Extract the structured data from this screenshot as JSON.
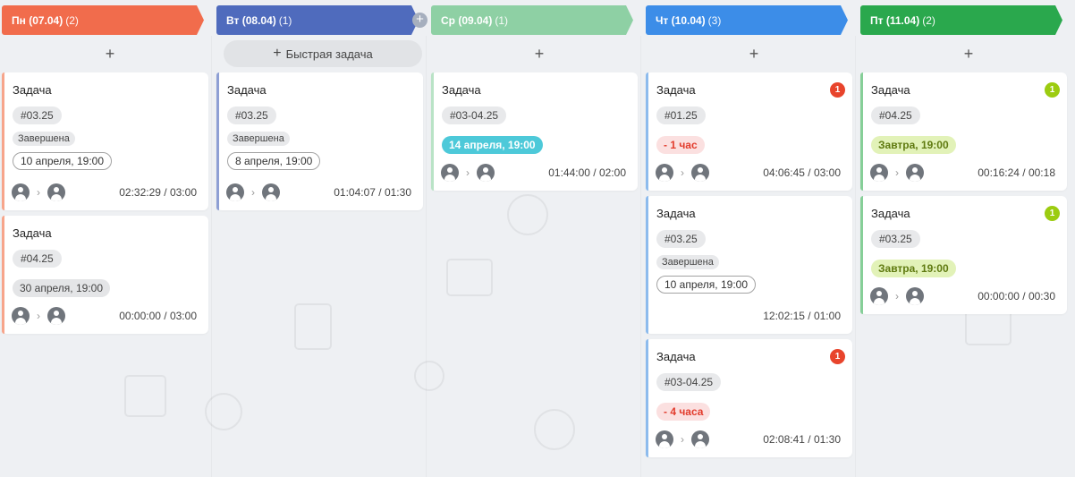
{
  "colors": {
    "mon": "#f16c4c",
    "tue": "#4f6bbd",
    "wed": "#8ed0a4",
    "thu": "#3c8de8",
    "fri": "#2aa84d"
  },
  "icons": {
    "add": "plus-icon",
    "avatar": "user-icon",
    "chevron": "chevron-right-icon"
  },
  "add_sign": "+",
  "chevron_glyph": "›",
  "columns": [
    {
      "title": "Пн (07.04)",
      "count": "(2)",
      "cards": [
        {
          "title": "Задача",
          "tag": "#03.25",
          "status": "Завершена",
          "date": "10 апреля, 19:00",
          "time": "02:32:29 / 03:00"
        },
        {
          "title": "Задача",
          "tag": "#04.25",
          "date": "30 апреля, 19:00",
          "time": "00:00:00 / 03:00"
        }
      ]
    },
    {
      "title": "Вт (08.04)",
      "count": "(1)",
      "quick_add": "Быстрая задача",
      "cards": [
        {
          "title": "Задача",
          "tag": "#03.25",
          "status": "Завершена",
          "date": "8 апреля, 19:00",
          "time": "01:04:07 / 01:30"
        }
      ]
    },
    {
      "title": "Ср (09.04)",
      "count": "(1)",
      "cards": [
        {
          "title": "Задача",
          "tag": "#03-04.25",
          "date": "14 апреля, 19:00",
          "time": "01:44:00 / 02:00"
        }
      ]
    },
    {
      "title": "Чт (10.04)",
      "count": "(3)",
      "cards": [
        {
          "title": "Задача",
          "badge": "1",
          "tag": "#01.25",
          "date": "- 1 час",
          "time": "04:06:45 / 03:00"
        },
        {
          "title": "Задача",
          "tag": "#03.25",
          "status": "Завершена",
          "date": "10 апреля, 19:00",
          "time": "12:02:15 / 01:00"
        },
        {
          "title": "Задача",
          "badge": "1",
          "tag": "#03-04.25",
          "date": "- 4 часа",
          "time": "02:08:41 / 01:30"
        }
      ]
    },
    {
      "title": "Пт (11.04)",
      "count": "(2)",
      "cards": [
        {
          "title": "Задача",
          "badge": "1",
          "tag": "#04.25",
          "date": "Завтра, 19:00",
          "time": "00:16:24 / 00:18"
        },
        {
          "title": "Задача",
          "badge": "1",
          "tag": "#03.25",
          "date": "Завтра, 19:00",
          "time": "00:00:00 / 00:30"
        }
      ]
    }
  ]
}
